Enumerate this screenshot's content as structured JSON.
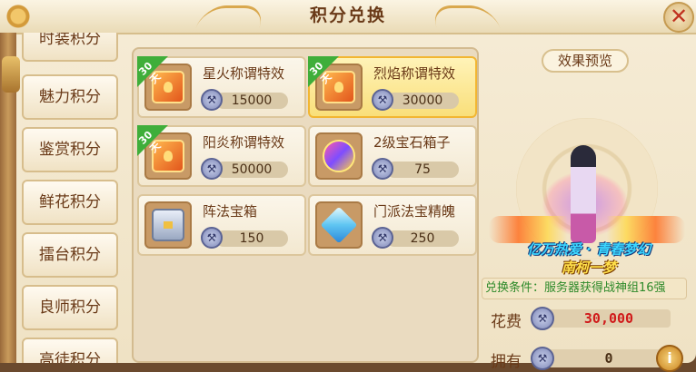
{
  "window": {
    "title": "积分兑换",
    "close_label": "✕"
  },
  "tabs": [
    {
      "label": "时装积分"
    },
    {
      "label": "魅力积分"
    },
    {
      "label": "鉴赏积分"
    },
    {
      "label": "鲜花积分"
    },
    {
      "label": "擂台积分"
    },
    {
      "label": "良师积分"
    },
    {
      "label": "高徒积分"
    }
  ],
  "items": [
    {
      "name": "星火称谓特效",
      "price": "15000",
      "badge": "30天",
      "icon": "flame-title-book-icon"
    },
    {
      "name": "烈焰称谓特效",
      "price": "30000",
      "badge": "30天",
      "icon": "flame-title-book-icon",
      "selected": true
    },
    {
      "name": "阳炎称谓特效",
      "price": "50000",
      "badge": "30天",
      "icon": "flame-title-book-icon"
    },
    {
      "name": "2级宝石箱子",
      "price": "75",
      "icon": "gem-box-icon"
    },
    {
      "name": "阵法宝箱",
      "price": "150",
      "icon": "treasure-chest-icon"
    },
    {
      "name": "门派法宝精魄",
      "price": "250",
      "icon": "crystal-icon"
    }
  ],
  "preview": {
    "label": "效果预览",
    "effect_text_line1": "亿万热爱 · 青春梦幻",
    "effect_text_line2": "南柯一梦",
    "condition": "兑换条件：服务器获得战神组16强",
    "cost_label": "花费",
    "cost_value": "30,000",
    "own_label": "拥有",
    "own_value": "0",
    "info_label": "i"
  },
  "colors": {
    "accent": "#f2b632",
    "text_brown": "#6a3a18",
    "price_red": "#d01a1a",
    "condition_green": "#2e8a2a",
    "badge_green": "#3fae3a"
  }
}
